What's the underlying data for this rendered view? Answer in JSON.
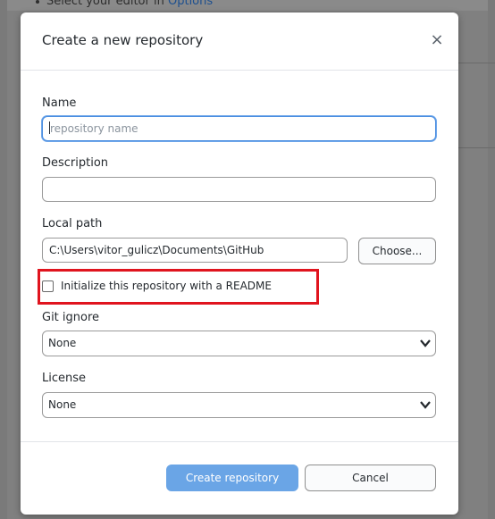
{
  "background": {
    "top_text": "Select your editor in",
    "top_link": "Options"
  },
  "dialog": {
    "title": "Create a new repository",
    "close_glyph": "×"
  },
  "fields": {
    "name_label": "Name",
    "name_placeholder": "repository name",
    "description_label": "Description",
    "description_value": "",
    "local_path_label": "Local path",
    "local_path_value": "C:\\Users\\vitor_gulicz\\Documents\\GitHub",
    "choose_button": "Choose...",
    "readme_checkbox_label": "Initialize this repository with a README",
    "readme_checked": false,
    "gitignore_label": "Git ignore",
    "gitignore_value": "None",
    "license_label": "License",
    "license_value": "None"
  },
  "footer": {
    "create_button": "Create repository",
    "cancel_button": "Cancel"
  },
  "colors": {
    "primary_button": "#6aa5e6",
    "focus_ring": "#4a8ee0",
    "highlight": "#e0141e"
  }
}
